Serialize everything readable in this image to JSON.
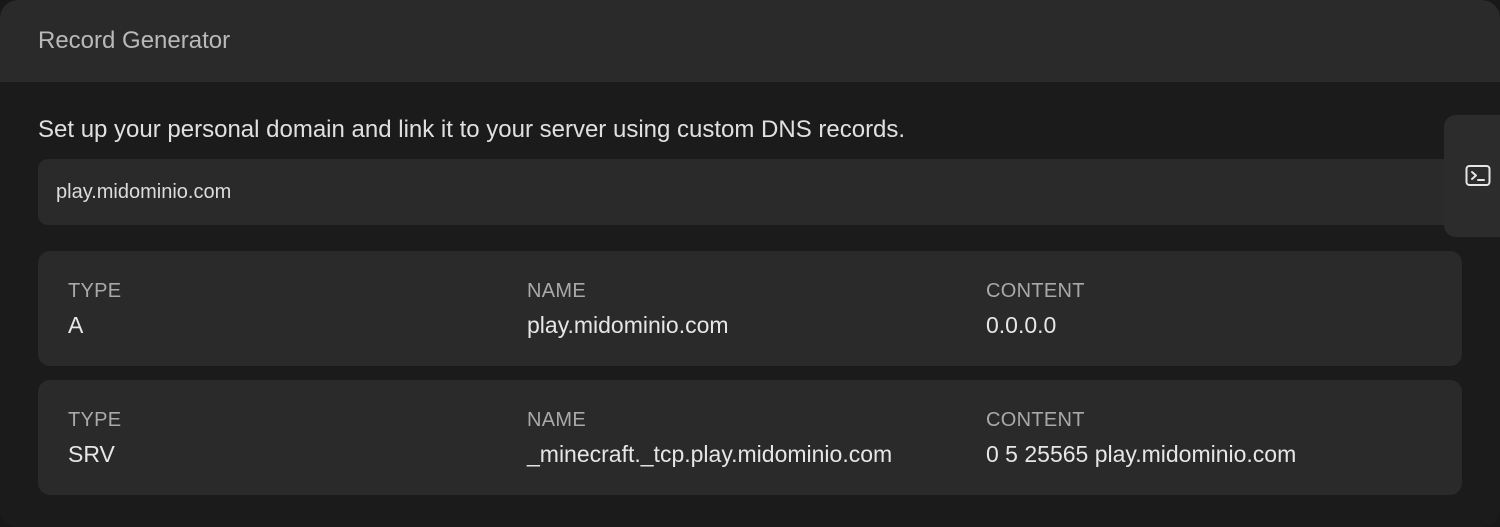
{
  "panel": {
    "title": "Record Generator"
  },
  "description": "Set up your personal domain and link it to your server using custom DNS records.",
  "domain_input": {
    "value": "play.midominio.com"
  },
  "side_tab": {
    "icon": "terminal-icon"
  },
  "records": [
    {
      "type_label": "TYPE",
      "type": "A",
      "name_label": "NAME",
      "name": "play.midominio.com",
      "content_label": "CONTENT",
      "content": "0.0.0.0"
    },
    {
      "type_label": "TYPE",
      "type": "SRV",
      "name_label": "NAME",
      "name": "_minecraft._tcp.play.midominio.com",
      "content_label": "CONTENT",
      "content": "0 5 25565 play.midominio.com"
    }
  ],
  "colors": {
    "background": "#1b1b1b",
    "surface": "#2a2a2a",
    "label": "#a9a9a9",
    "text": "#e6e6e6"
  }
}
